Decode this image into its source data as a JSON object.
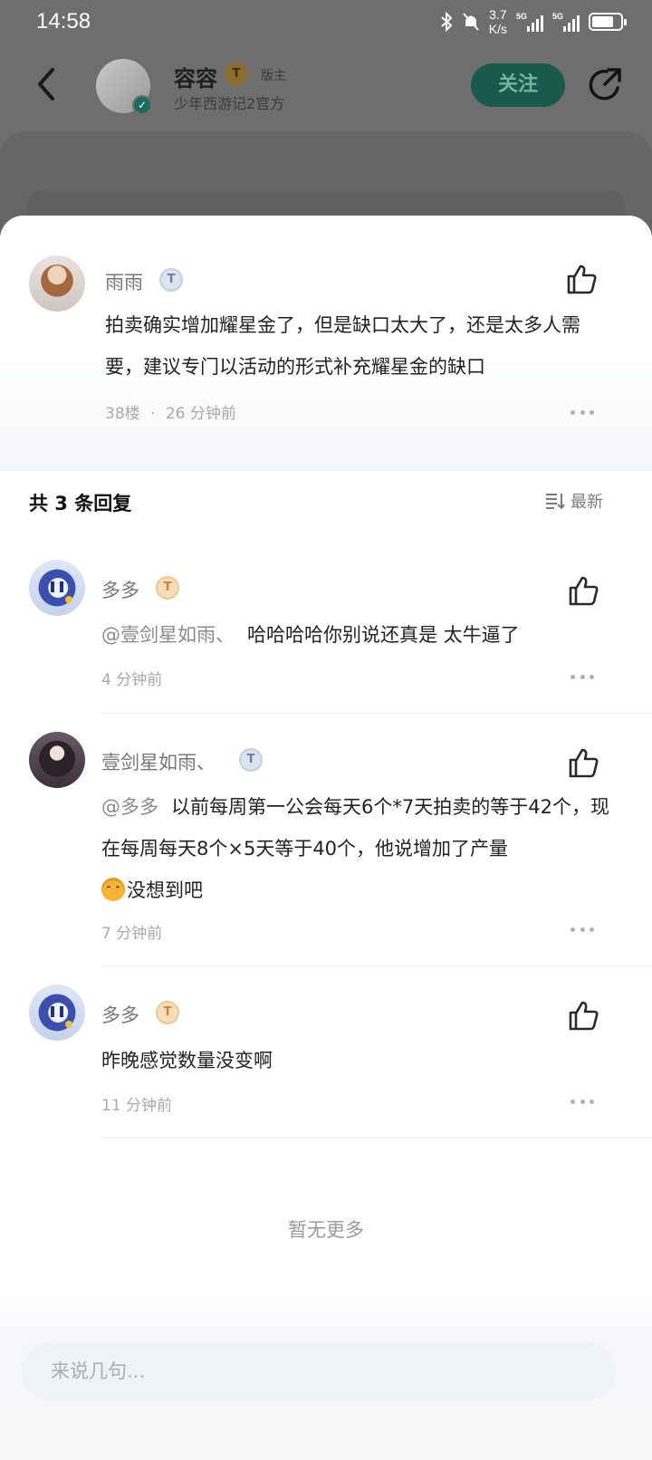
{
  "status_bar": {
    "time": "14:58",
    "speed_value": "3.7",
    "speed_unit": "K/s",
    "network1": "5G",
    "network2": "5G"
  },
  "header": {
    "poster_name": "容容",
    "poster_badge": "T",
    "poster_role": "版主",
    "poster_subtitle": "少年西游记2官方",
    "follow_label": "关注"
  },
  "main_comment": {
    "user": "雨雨",
    "badge": "T",
    "text": "拍卖确实增加耀星金了，但是缺口太大了，还是太多人需要，建议专门以活动的形式补充耀星金的缺口",
    "floor": "38楼",
    "separator": "·",
    "time": "26 分钟前"
  },
  "replies_header": {
    "count_label": "共 3 条回复",
    "sort_label": "最新"
  },
  "replies": [
    {
      "user": "多多",
      "badge": "T",
      "mention": "@壹剑星如雨、",
      "text": "哈哈哈哈你别说还真是 太牛逼了",
      "time": "4 分钟前"
    },
    {
      "user": "壹剑星如雨、",
      "badge": "T",
      "mention": "@多多",
      "text": "以前每周第一公会每天6个*7天拍卖的等于42个，现在每周每天8个×5天等于40个，他说增加了产量",
      "text_after_emoji": "没想到吧",
      "time": "7 分钟前"
    },
    {
      "user": "多多",
      "badge": "T",
      "text": "昨晚感觉数量没变啊",
      "time": "11 分钟前"
    }
  ],
  "no_more_label": "暂无更多",
  "input": {
    "placeholder": "来说几句..."
  },
  "colors": {
    "accent_follow": "#1a5a4c",
    "overlay": "#6e6e6e",
    "sheet": "#ffffff"
  }
}
